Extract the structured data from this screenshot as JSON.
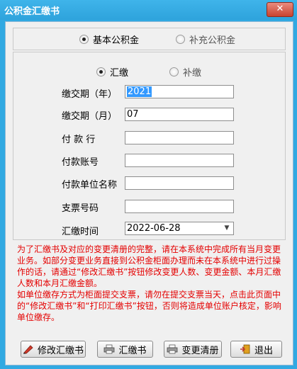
{
  "window": {
    "title": "公积金汇缴书",
    "close_glyph": "✕"
  },
  "fund_type": {
    "options": [
      "基本公积金",
      "补充公积金"
    ],
    "selected": "基本公积金"
  },
  "pay_type": {
    "options": [
      "汇缴",
      "补缴"
    ],
    "selected": "汇缴"
  },
  "form": {
    "year_label": "缴交期（年）",
    "year_value": "2021",
    "month_label": "缴交期（月）",
    "month_value": "07",
    "payer_label": "付 款 行",
    "payer_value": "",
    "account_label": "付款账号",
    "account_value": "",
    "unit_label": "付款单位名称",
    "unit_value": "",
    "cheque_label": "支票号码",
    "cheque_value": "",
    "time_label": "汇缴时间",
    "time_value": "2022-06-28"
  },
  "notice": {
    "p1": "为了汇缴书及对应的变更清册的完整，请在本系统中完成所有当月变更业务。如部分变更业务直接到公积金柜面办理而未在本系统中进行过操作的话，请通过“修改汇缴书”按钮修改变更人数、变更金额、本月汇缴人数和本月汇缴金额。",
    "p2": "如单位缴存方式为柜面提交支票，请勿在提交支票当天，点击此页面中的“修改汇缴书”和“打印汇缴书”按钮，否则将造成单位账户核定，影响单位缴存。"
  },
  "buttons": {
    "modify": "修改汇缴书",
    "print": "汇缴书",
    "changes": "变更清册",
    "exit": "退出"
  },
  "colors": {
    "title_bar": "#31a9e2",
    "notice_text": "#e40000",
    "selection": "#3399ff"
  }
}
